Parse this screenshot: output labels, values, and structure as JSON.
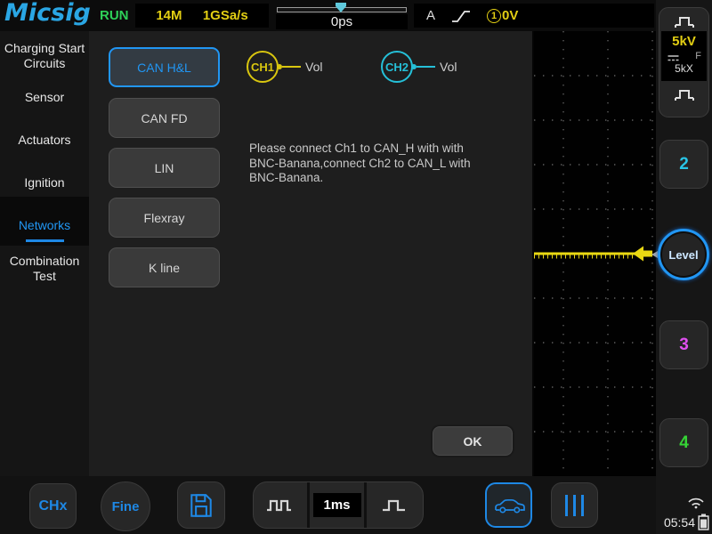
{
  "colors": {
    "accent_blue": "#2196f3",
    "ch1_yellow": "#d9c60f",
    "ch2_cyan": "#25c0d8",
    "ch3_magenta": "#e04ff0",
    "ch4_green": "#35d435",
    "run_green": "#2ed058"
  },
  "top_bar": {
    "logo": "Micsig",
    "run_status": "RUN",
    "memory_depth": "14M",
    "sample_rate": "1GSa/s",
    "horizontal_position": "0ps",
    "trigger_source": "A",
    "trigger_channel_number": "1",
    "trigger_level": "0V"
  },
  "sidebar": {
    "selected": "Networks",
    "items": [
      {
        "label": "Charging Start Circuits"
      },
      {
        "label": "Sensor"
      },
      {
        "label": "Actuators"
      },
      {
        "label": "Ignition"
      },
      {
        "label": "Networks"
      },
      {
        "label": "Combination Test"
      }
    ]
  },
  "menu": {
    "buttons": [
      {
        "label": "CAN H&L",
        "selected": true
      },
      {
        "label": "CAN FD",
        "selected": false
      },
      {
        "label": "LIN",
        "selected": false
      },
      {
        "label": "Flexray",
        "selected": false
      },
      {
        "label": "K line",
        "selected": false
      }
    ],
    "channels": [
      {
        "name": "CH1",
        "signal": "Vol"
      },
      {
        "name": "CH2",
        "signal": "Vol"
      }
    ],
    "instruction_lines": [
      "Please connect Ch1 to CAN_H with with",
      "BNC-Banana,connect Ch2 to CAN_L with",
      "BNC-Banana."
    ],
    "ok_label": "OK"
  },
  "right_panel": {
    "scale_value": "5kV",
    "filter_flag": "F",
    "attenuation": "5kX",
    "channel2_label": "2",
    "level_label": "Level",
    "channel3_label": "3",
    "channel4_label": "4",
    "clock": "05:54"
  },
  "bottom_bar": {
    "chx_label": "CHx",
    "fine_label": "Fine",
    "timebase": "1ms"
  },
  "icons": {
    "trigger_position_marker": "cyan flag pointer",
    "rising_edge": "rising slope",
    "trigger_channel_badge": "circled 1",
    "scale_up": "pulse up",
    "scale_down": "pulse down",
    "dc_coupling": "solid line over dashed line",
    "save": "floppy disk",
    "pulse_train": "double pulse",
    "single_pulse": "single pulse",
    "automotive": "car outline",
    "menu_bars": "three vertical bars",
    "wifi": "signal arcs",
    "battery": "battery"
  }
}
